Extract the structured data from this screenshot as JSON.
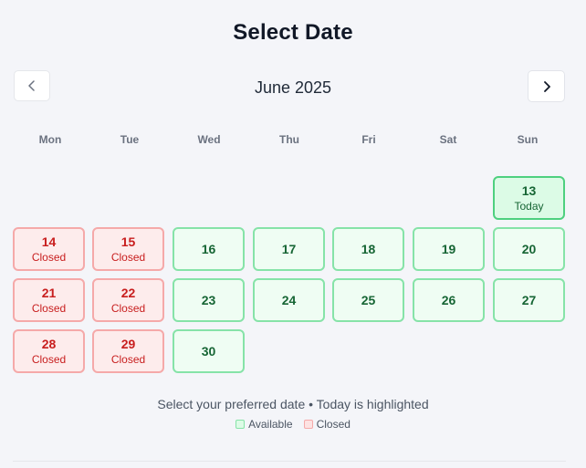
{
  "title": "Select Date",
  "month": "June 2025",
  "nav": {
    "prev_icon": "chevron-left-icon",
    "next_icon": "chevron-right-icon"
  },
  "weekdays": [
    "Mon",
    "Tue",
    "Wed",
    "Thu",
    "Fri",
    "Sat",
    "Sun"
  ],
  "days": [
    {
      "day": "13",
      "status": "today",
      "label": "Today"
    },
    {
      "day": "14",
      "status": "closed",
      "label": "Closed"
    },
    {
      "day": "15",
      "status": "closed",
      "label": "Closed"
    },
    {
      "day": "16",
      "status": "available",
      "label": ""
    },
    {
      "day": "17",
      "status": "available",
      "label": ""
    },
    {
      "day": "18",
      "status": "available",
      "label": ""
    },
    {
      "day": "19",
      "status": "available",
      "label": ""
    },
    {
      "day": "20",
      "status": "available",
      "label": ""
    },
    {
      "day": "21",
      "status": "closed",
      "label": "Closed"
    },
    {
      "day": "22",
      "status": "closed",
      "label": "Closed"
    },
    {
      "day": "23",
      "status": "available",
      "label": ""
    },
    {
      "day": "24",
      "status": "available",
      "label": ""
    },
    {
      "day": "25",
      "status": "available",
      "label": ""
    },
    {
      "day": "26",
      "status": "available",
      "label": ""
    },
    {
      "day": "27",
      "status": "available",
      "label": ""
    },
    {
      "day": "28",
      "status": "closed",
      "label": "Closed"
    },
    {
      "day": "29",
      "status": "closed",
      "label": "Closed"
    },
    {
      "day": "30",
      "status": "available",
      "label": ""
    }
  ],
  "helper_text": "Select your preferred date • Today is highlighted",
  "legend": {
    "available": "Available",
    "closed": "Closed"
  },
  "colors": {
    "available_bg": "#effdf3",
    "available_border": "#86e3a8",
    "available_text": "#166534",
    "closed_bg": "#fdecec",
    "closed_border": "#f5a9a9",
    "closed_text": "#c81e1e",
    "today_bg": "#dcfbe6",
    "today_border": "#4ed07f"
  }
}
